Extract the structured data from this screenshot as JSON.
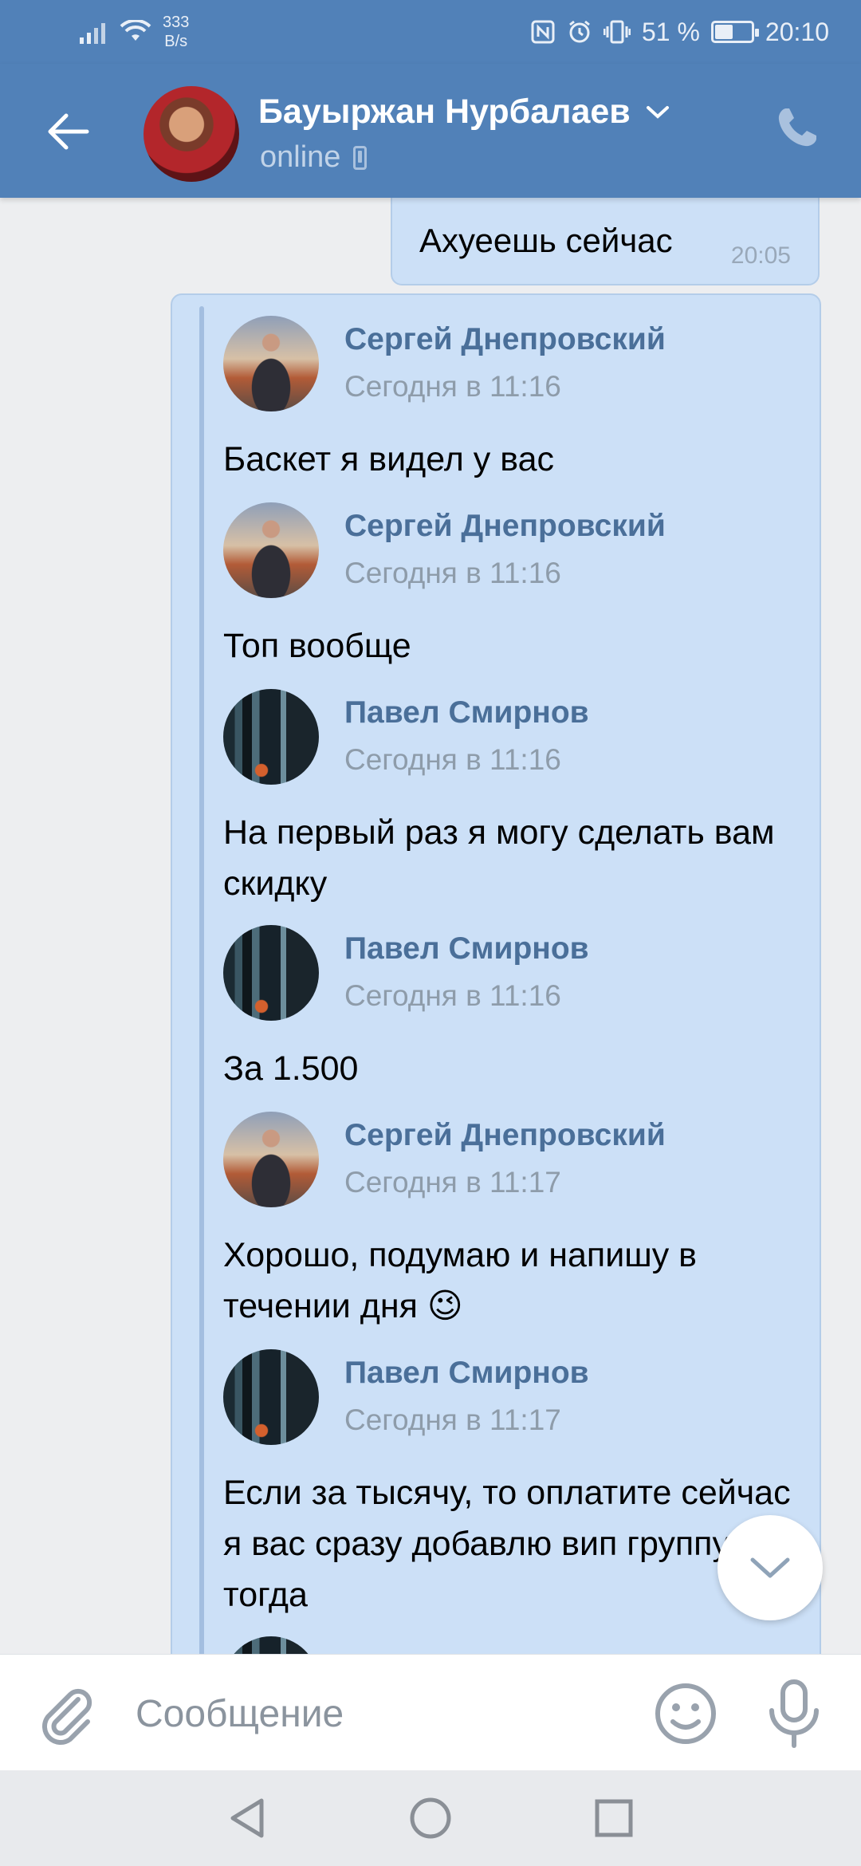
{
  "status_bar": {
    "net_speed_value": "333",
    "net_speed_unit": "B/s",
    "battery": "51 %",
    "battery_level": 0.51,
    "time": "20:10"
  },
  "header": {
    "contact_name": "Бауыржан Нурбалаев",
    "status": "online"
  },
  "top_message": {
    "text": "Ахуеешь сейчас",
    "time": "20:05"
  },
  "forwarded_messages": [
    {
      "author": "Сергей Днепровский",
      "date": "Сегодня в 11:16",
      "text": "Баскет я видел у вас",
      "avatar": "sergey"
    },
    {
      "author": "Сергей Днепровский",
      "date": "Сегодня в 11:16",
      "text": "Топ вообще",
      "avatar": "sergey"
    },
    {
      "author": "Павел Смирнов",
      "date": "Сегодня в 11:16",
      "text": "На первый раз я могу сделать вам скидку",
      "avatar": "pavel"
    },
    {
      "author": "Павел Смирнов",
      "date": "Сегодня в 11:16",
      "text": "За 1.500",
      "avatar": "pavel"
    },
    {
      "author": "Сергей Днепровский",
      "date": "Сегодня в 11:17",
      "text": "Хорошо, подумаю и напишу в течении дня 😉",
      "avatar": "sergey"
    },
    {
      "author": "Павел Смирнов",
      "date": "Сегодня в 11:17",
      "text": "Если за тысячу, то оплатите сейчас я вас сразу добавлю вип группу тогда",
      "avatar": "pavel"
    },
    {
      "author": "Павел Смирнов",
      "date": "",
      "text": "",
      "avatar": "pavel"
    }
  ],
  "composer": {
    "placeholder": "Сообщение"
  },
  "icons": {
    "back": "arrow-left-icon",
    "dropdown": "chevron-down-icon",
    "call": "phone-icon",
    "scroll_down": "chevron-down-icon",
    "attach": "paperclip-icon",
    "emoji": "smile-icon",
    "voice": "microphone-icon"
  },
  "colors": {
    "header": "#5181b8",
    "bubble": "#cce0f7",
    "author": "#4a6f99"
  }
}
